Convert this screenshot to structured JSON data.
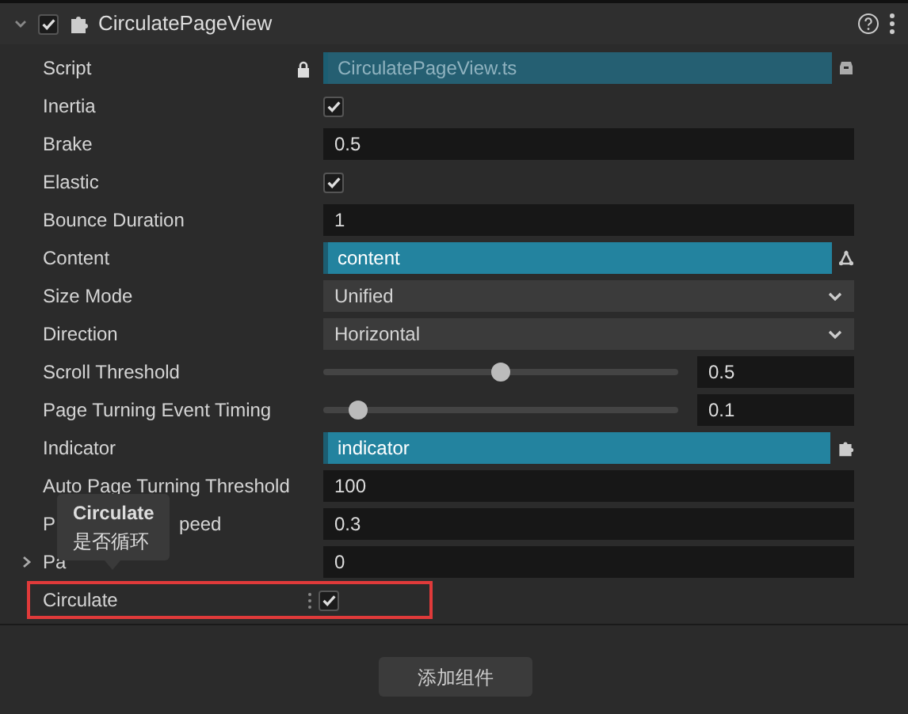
{
  "component": {
    "title": "CirculatePageView",
    "enabled": true,
    "expanded": true
  },
  "properties": [
    {
      "kind": "script",
      "label": "Script",
      "value": "CirculatePageView.ts"
    },
    {
      "kind": "checkbox",
      "label": "Inertia",
      "checked": true
    },
    {
      "kind": "number",
      "label": "Brake",
      "value": "0.5"
    },
    {
      "kind": "checkbox",
      "label": "Elastic",
      "checked": true
    },
    {
      "kind": "number",
      "label": "Bounce Duration",
      "value": "1"
    },
    {
      "kind": "node_ref",
      "label": "Content",
      "value": "content"
    },
    {
      "kind": "select",
      "label": "Size Mode",
      "value": "Unified"
    },
    {
      "kind": "select",
      "label": "Direction",
      "value": "Horizontal"
    },
    {
      "kind": "slider",
      "label": "Scroll Threshold",
      "level": 0.5,
      "value": "0.5"
    },
    {
      "kind": "slider",
      "label": "Page Turning Event Timing",
      "level": 0.1,
      "value": "0.1"
    },
    {
      "kind": "component_ref",
      "label": "Indicator",
      "value": "indicator"
    },
    {
      "kind": "number",
      "label": "Auto Page Turning Threshold",
      "value": "100"
    },
    {
      "kind": "number",
      "label_parts": [
        "P",
        "peed"
      ],
      "value": "0.3"
    },
    {
      "kind": "number",
      "label": "Pa",
      "value": "0",
      "expandable": true
    },
    {
      "kind": "checkbox",
      "label": "Circulate",
      "checked": true,
      "highlighted": true
    }
  ],
  "tooltip": {
    "title": "Circulate",
    "text": "是否循环"
  },
  "add_button": "添加组件"
}
